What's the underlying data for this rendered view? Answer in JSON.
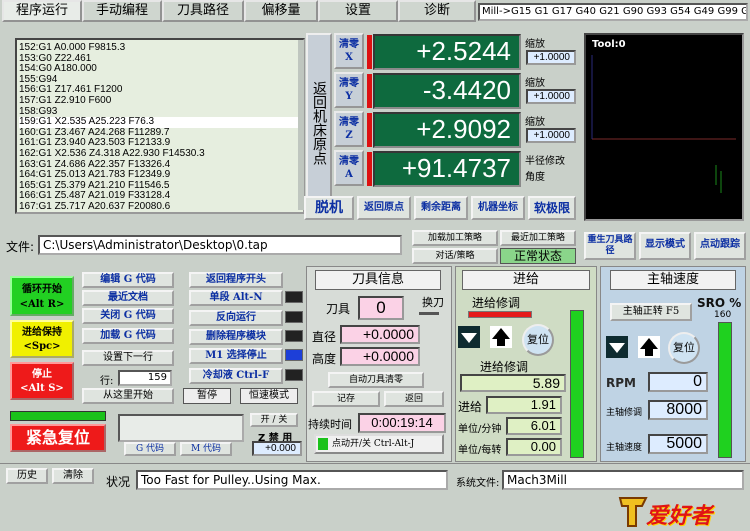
{
  "tabs": [
    "程序运行",
    "手动编程",
    "刀具路径",
    "偏移量",
    "设置",
    "诊断"
  ],
  "status_modal": "Mill->G15  G1 G17 G40 G21 G90 G93 G54 G49 G99 G64",
  "gcode_lines": [
    "152:G1 A0.000 F9815.3",
    "153:G0 Z22.461",
    "154:G0 A180.000",
    "155:G94",
    "156:G1 Z17.461 F1200",
    "157:G1 Z2.910 F600",
    "158:G93",
    "159:G1 X2.535 A25.223 F76.3",
    "160:G1 Z3.467 A24.268 F11289.7",
    "161:G1 Z3.940 A23.503 F12133.9",
    "162:G1 X2.536 Z4.318 A22.930 F14530.3",
    "163:G1 Z4.686 A22.357 F13326.4",
    "164:G1 Z5.013 A21.783 F12349.9",
    "165:G1 Z5.379 A21.210 F11546.5",
    "166:G1 Z5.487 A21.019 F33128.4",
    "167:G1 Z5.717 A20.637 F20080.6"
  ],
  "highlight_line": 7,
  "ref_home_label": "返回机床原点",
  "axes": [
    {
      "zero_label": "清零",
      "axis": "X",
      "value": "+2.5244",
      "scale_label": "缩放",
      "scale": "+1.0000"
    },
    {
      "zero_label": "清零",
      "axis": "Y",
      "value": "-3.4420",
      "scale_label": "缩放",
      "scale": "+1.0000"
    },
    {
      "zero_label": "清零",
      "axis": "Z",
      "value": "+2.9092",
      "scale_label": "缩放",
      "scale": "+1.0000"
    },
    {
      "zero_label": "清零",
      "axis": "A",
      "value": "+91.4737",
      "scale_label": "半径修改",
      "scale": "角度"
    }
  ],
  "dro_buttons": [
    "脱机",
    "返回原点",
    "剩余距离",
    "机器坐标",
    "软极限"
  ],
  "toolpath_label": "Tool:0",
  "file_label": "文件:",
  "file_path": "C:\\Users\\Administrator\\Desktop\\0.tap",
  "strategy": {
    "load": "加载加工策略",
    "recent": "最近加工策略",
    "dialog": "对话/策略",
    "status": "正常状态"
  },
  "view_buttons": [
    "重生刀具路径",
    "显示模式",
    "点动跟踪"
  ],
  "cycle": {
    "start": "循环开始",
    "start_key": "<Alt R>",
    "hold": "进给保持",
    "hold_key": "<Spc>",
    "stop": "停止",
    "stop_key": "<Alt S>"
  },
  "file_buttons": [
    "编辑 G 代码",
    "最近文档",
    "关闭 G 代码",
    "加载 G 代码",
    "设置下一行"
  ],
  "line_label": "行:",
  "line_value": "159",
  "run_from_here": "从这里开始",
  "program_buttons": [
    "返回程序开头",
    "单段 Alt-N",
    "反向运行",
    "删除程序模块",
    "M1 选择停止",
    "冷却液 Ctrl-F"
  ],
  "pause_label": "暂停",
  "const_vel": "恒速模式",
  "estop": "紧急复位",
  "gcode_btn": "G 代码",
  "mcode_btn": "M 代码",
  "onoff": "开 / 关",
  "z_inhibit": "Z 禁 用",
  "z_inhibit_val": "+0.000",
  "tool": {
    "title": "刀具信息",
    "tool_label": "刀具",
    "tool_val": "0",
    "change": "换刀",
    "dia_label": "直径",
    "dia_val": "+0.0000",
    "height_label": "高度",
    "height_val": "+0.0000",
    "auto_zero": "自动刀具清零",
    "remember": "记存",
    "return": "返回",
    "elapsed_label": "持续时间",
    "elapsed": "0:00:19:14",
    "jog": "点动开/关 Ctrl-Alt-J"
  },
  "feed": {
    "title": "进给",
    "override_label": "进给修调",
    "reset": "复位",
    "override2_label": "进给修调",
    "override_val": "5.89",
    "feed_label": "进给",
    "feed_val": "1.91",
    "per_min_label": "单位/分钟",
    "per_min": "6.01",
    "per_rev_label": "单位/每转",
    "per_rev": "0.00"
  },
  "spindle": {
    "title": "主轴速度",
    "fwd": "主轴正转 F5",
    "sro": "SRO %",
    "sro_val": "160",
    "reset": "复位",
    "rpm_label": "RPM",
    "rpm": "0",
    "override_label": "主轴修调",
    "override": "8000",
    "actual_label": "主轴速度",
    "actual": "5000"
  },
  "bottom": {
    "history": "历史",
    "clear": "清除",
    "status_label": "状况",
    "status": "Too Fast for Pulley..Using Max.",
    "profile_label": "系统文件:",
    "profile": "Mach3Mill",
    "logo": "爱好者"
  }
}
